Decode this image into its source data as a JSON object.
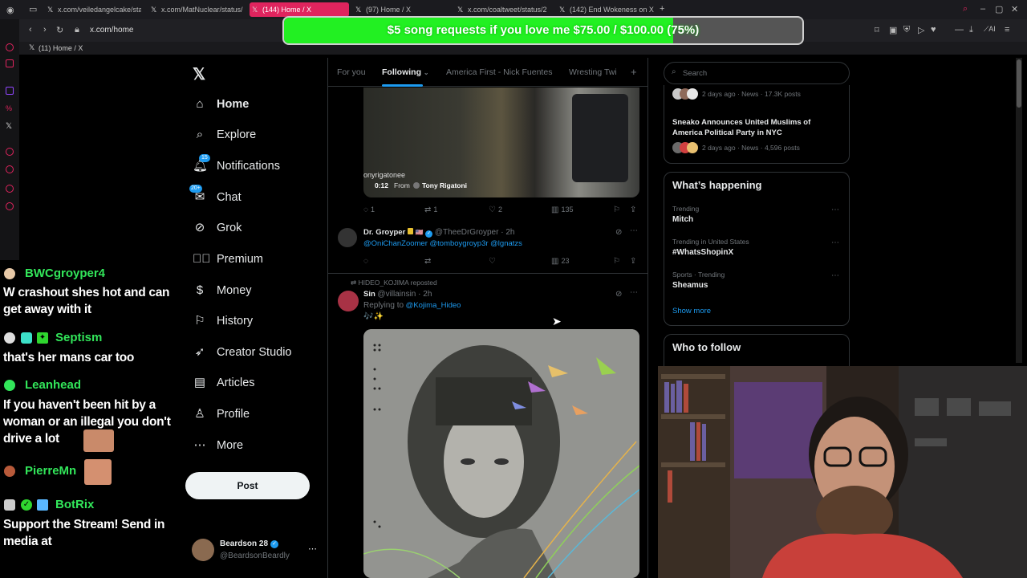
{
  "browser": {
    "tabs": [
      {
        "label": "x.com/veiledangelcake/sta",
        "active": false
      },
      {
        "label": "x.com/MatNuclear/status/",
        "active": false
      },
      {
        "label": "(144) Home / X",
        "active": true
      },
      {
        "label": "(97) Home / X",
        "active": false
      },
      {
        "label": "x.com/coaltweet/status/2",
        "active": false
      },
      {
        "label": "(142) End Wokeness on X",
        "active": false
      }
    ],
    "address": "x.com/home",
    "bookmark": "(11) Home / X"
  },
  "donation": {
    "text": "$5 song requests if you love me $75.00 / $100.00 (75%)",
    "progress": 0.75
  },
  "chat": [
    {
      "user": "BWCgroyper4",
      "message": "W crashout shes hot and can get away with it"
    },
    {
      "user": "Septism",
      "message": "that's her mans car too"
    },
    {
      "user": "Leanhead",
      "message": "If you haven't been hit by a woman or an illegal you don't drive a lot"
    },
    {
      "user": "PierreMn",
      "message": ""
    },
    {
      "user": "BotRix",
      "message": "Support the Stream! Send in media at"
    }
  ],
  "sidebar": {
    "items": [
      {
        "label": "Home",
        "icon": "home-icon"
      },
      {
        "label": "Explore",
        "icon": "search-icon"
      },
      {
        "label": "Notifications",
        "icon": "bell-icon",
        "badge": "15"
      },
      {
        "label": "Chat",
        "icon": "mail-icon",
        "badge": "20+"
      },
      {
        "label": "Grok",
        "icon": "grok-icon"
      },
      {
        "label": "Premium",
        "icon": "premium-icon"
      },
      {
        "label": "Money",
        "icon": "money-icon"
      },
      {
        "label": "History",
        "icon": "bookmark-icon"
      },
      {
        "label": "Creator Studio",
        "icon": "rocket-icon"
      },
      {
        "label": "Articles",
        "icon": "article-icon"
      },
      {
        "label": "Profile",
        "icon": "person-icon"
      },
      {
        "label": "More",
        "icon": "more-icon"
      }
    ],
    "post_label": "Post",
    "account": {
      "name": "Beardson 28",
      "handle": "@BeardsonBeardly"
    }
  },
  "feed": {
    "tabs": [
      "For you",
      "Following",
      "America First - Nick Fuentes",
      "Wresting Twi"
    ],
    "video": {
      "overlay_text": "onyrigatonee",
      "duration": "0:12",
      "from": "From",
      "source": "Tony Rigatoni"
    },
    "tweet1_actions": {
      "replies": "1",
      "retweets": "1",
      "likes": "2",
      "views": "135"
    },
    "tweet2": {
      "name": "Dr. Groyper",
      "flag": "🇺🇸",
      "handle": "@TheeDrGroyper · 2h",
      "text": "@OniChanZoomer @tomboygroyp3r @lgnatzs"
    },
    "tweet2_actions": {
      "views": "23"
    },
    "tweet3": {
      "repost_by": "HIDEO_KOJIMA reposted",
      "name": "Sin",
      "handle": "@villainsin · 2h",
      "replying_prefix": "Replying to",
      "replying_to": "@Kojima_Hideo",
      "text": "🎶✨"
    }
  },
  "right": {
    "search_placeholder": "Search",
    "news1": {
      "meta": "2 days ago · News · 17.3K posts"
    },
    "news2": {
      "title": "Sneako Announces United Muslims of America Political Party in NYC",
      "meta": "2 days ago · News · 4,596 posts"
    },
    "whats_happening": "What’s happening",
    "trends": [
      {
        "sub": "Trending",
        "name": "Mitch"
      },
      {
        "sub": "Trending in United States",
        "name": "#WhatsShopinX"
      },
      {
        "sub": "Sports · Trending",
        "name": "Sheamus"
      }
    ],
    "show_more": "Show more",
    "who_to_follow": "Who to follow"
  },
  "colors": {
    "accent": "#1d9bf0",
    "tab_active": "#e0245e",
    "donation_fill": "#22f022",
    "chat_name": "#32e65a"
  }
}
